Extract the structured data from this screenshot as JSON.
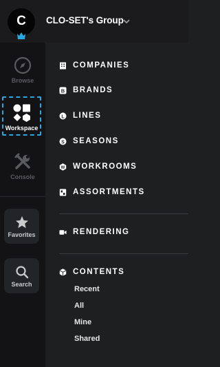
{
  "header": {
    "avatar_letter": "C",
    "group_name": "CLO-SET's Group"
  },
  "rail": {
    "browse_label": "Browse",
    "workspace_label": "Workspace",
    "console_label": "Console",
    "favorites_label": "Favorites",
    "search_label": "Search"
  },
  "menu": {
    "companies": "COMPANIES",
    "brands": "BRANDS",
    "lines": "LINES",
    "seasons": "SEASONS",
    "workrooms": "WORKROOMS",
    "assortments": "ASSORTMENTS",
    "rendering": "RENDERING",
    "contents": "CONTENTS"
  },
  "contents_items": [
    "Recent",
    "All",
    "Mine",
    "Shared"
  ],
  "colors": {
    "accent": "#2aa9e0",
    "background": "#1e1f21",
    "rail": "#131315"
  }
}
